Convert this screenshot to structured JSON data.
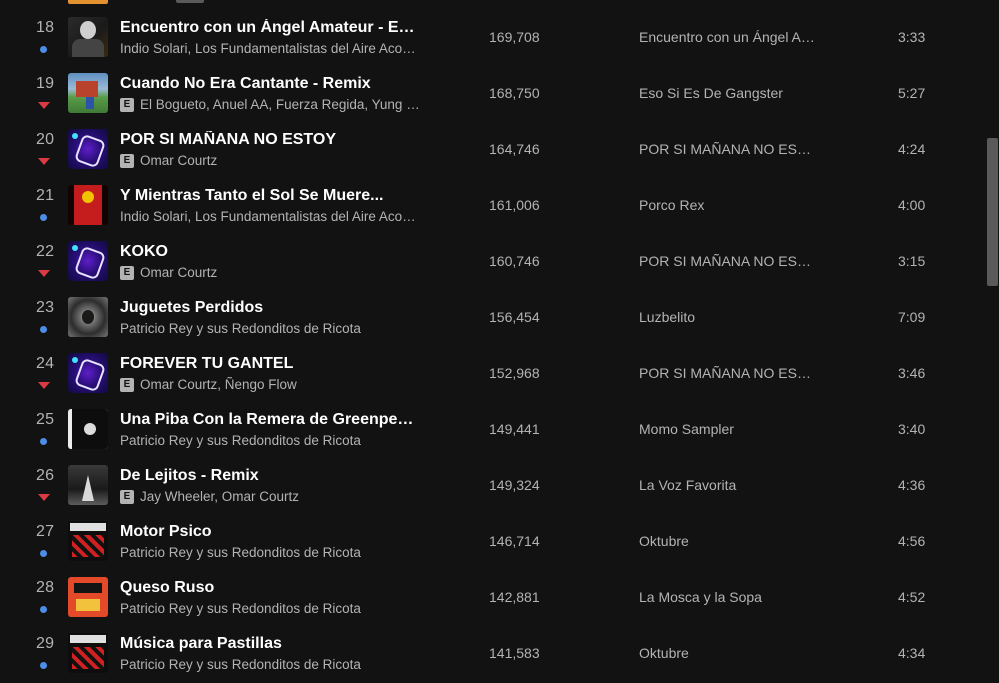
{
  "tracks": [
    {
      "rank": "18",
      "trend": "new",
      "title": "Encuentro con un Ángel Amateur - En Vivo",
      "explicit": false,
      "artists": "Indio Solari, Los Fundamentalistas del Aire Acondicionado",
      "streams": "169,708",
      "album": "Encuentro con un Ángel Amateur (En Vivo)",
      "duration": "3:33",
      "art": "art-encuentro"
    },
    {
      "rank": "19",
      "trend": "down",
      "title": "Cuando No Era Cantante - Remix",
      "explicit": true,
      "artists": "El Bogueto, Anuel AA, Fuerza Regida, Yung Beef",
      "streams": "168,750",
      "album": "Eso Si Es De Gangster",
      "duration": "5:27",
      "art": "art-cuando"
    },
    {
      "rank": "20",
      "trend": "down",
      "title": "POR SI MAÑANA NO ESTOY",
      "explicit": true,
      "artists": "Omar Courtz",
      "streams": "164,746",
      "album": "POR SI MAÑANA NO ESTOY",
      "duration": "4:24",
      "art": "art-omar"
    },
    {
      "rank": "21",
      "trend": "new",
      "title": "Y Mientras Tanto el Sol Se Muere...",
      "explicit": false,
      "artists": "Indio Solari, Los Fundamentalistas del Aire Acondicionado",
      "streams": "161,006",
      "album": "Porco Rex",
      "duration": "4:00",
      "art": "art-ymientras"
    },
    {
      "rank": "22",
      "trend": "down",
      "title": "KOKO",
      "explicit": true,
      "artists": "Omar Courtz",
      "streams": "160,746",
      "album": "POR SI MAÑANA NO ESTOY",
      "duration": "3:15",
      "art": "art-omar"
    },
    {
      "rank": "23",
      "trend": "new",
      "title": "Juguetes Perdidos",
      "explicit": false,
      "artists": "Patricio Rey y sus Redonditos de Ricota",
      "streams": "156,454",
      "album": "Luzbelito",
      "duration": "7:09",
      "art": "art-luzbelito"
    },
    {
      "rank": "24",
      "trend": "down",
      "title": "FOREVER TU GANTEL",
      "explicit": true,
      "artists": "Omar Courtz, Ñengo Flow",
      "streams": "152,968",
      "album": "POR SI MAÑANA NO ESTOY",
      "duration": "3:46",
      "art": "art-omar"
    },
    {
      "rank": "25",
      "trend": "new",
      "title": "Una Piba Con la Remera de Greenpeace",
      "explicit": false,
      "artists": "Patricio Rey y sus Redonditos de Ricota",
      "streams": "149,441",
      "album": "Momo Sampler",
      "duration": "3:40",
      "art": "art-momo"
    },
    {
      "rank": "26",
      "trend": "down",
      "title": "De Lejitos - Remix",
      "explicit": true,
      "artists": "Jay Wheeler, Omar Courtz",
      "streams": "149,324",
      "album": "La Voz Favorita",
      "duration": "4:36",
      "art": "art-voz"
    },
    {
      "rank": "27",
      "trend": "new",
      "title": "Motor Psico",
      "explicit": false,
      "artists": "Patricio Rey y sus Redonditos de Ricota",
      "streams": "146,714",
      "album": "Oktubre",
      "duration": "4:56",
      "art": "art-oktubre"
    },
    {
      "rank": "28",
      "trend": "new",
      "title": "Queso Ruso",
      "explicit": false,
      "artists": "Patricio Rey y sus Redonditos de Ricota",
      "streams": "142,881",
      "album": "La Mosca y la Sopa",
      "duration": "4:52",
      "art": "art-mosca"
    },
    {
      "rank": "29",
      "trend": "new",
      "title": "Música para Pastillas",
      "explicit": false,
      "artists": "Patricio Rey y sus Redonditos de Ricota",
      "streams": "141,583",
      "album": "Oktubre",
      "duration": "4:34",
      "art": "art-oktubre"
    }
  ],
  "explicit_badge": "E",
  "colors": {
    "background": "#121212",
    "new_marker": "#4e8de6",
    "down_marker": "#d93a44",
    "secondary_text": "#b3b3b3"
  }
}
